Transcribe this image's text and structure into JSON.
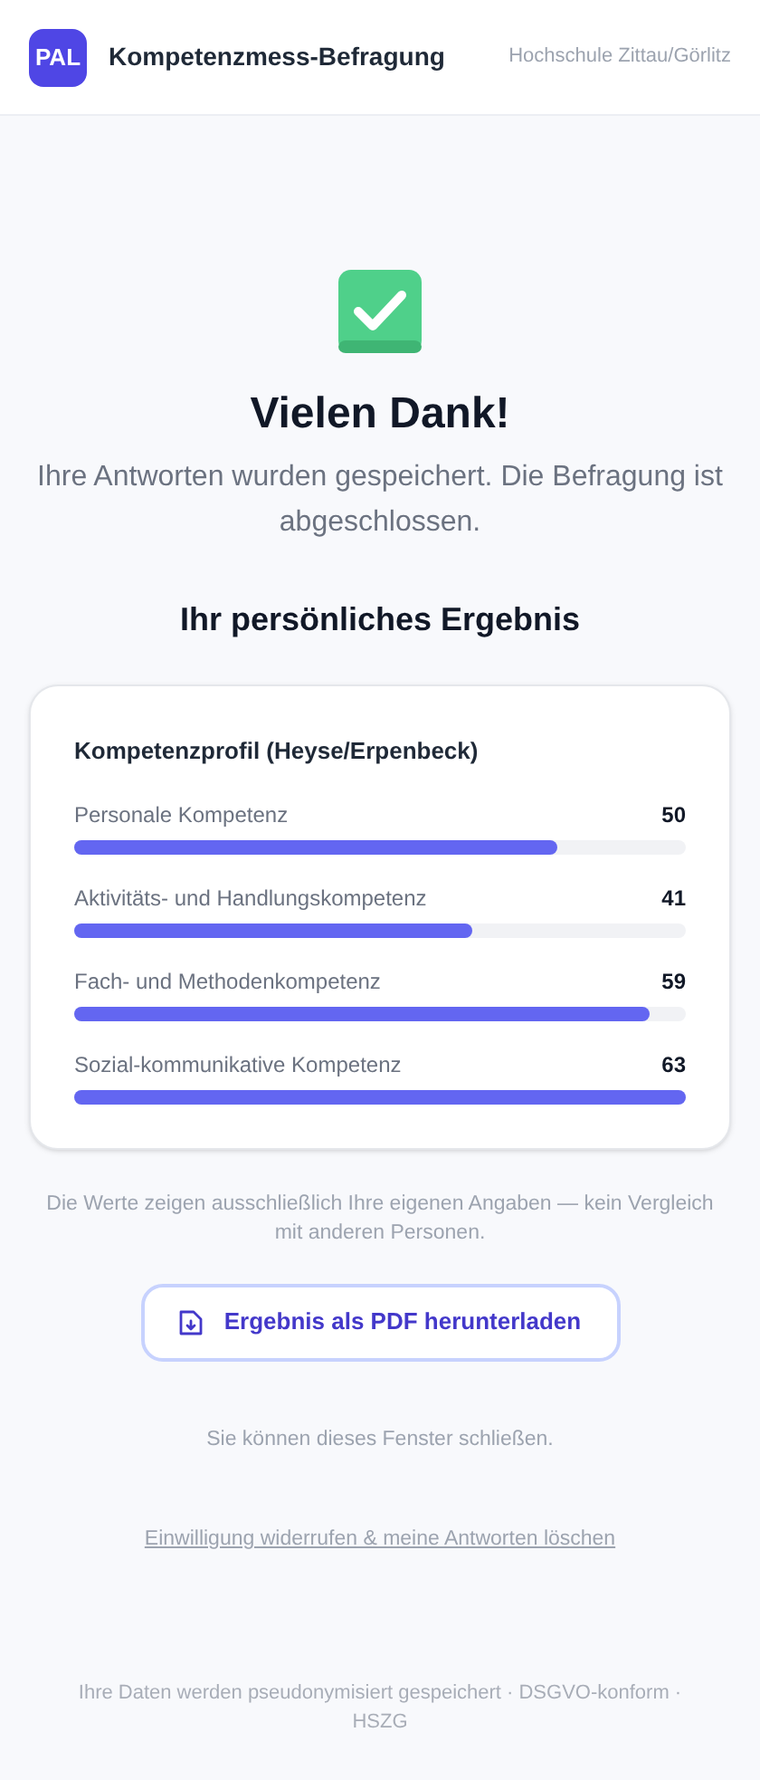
{
  "header": {
    "logo": "PAL",
    "title": "Kompetenzmess-Befragung",
    "institution": "Hochschule Zittau/Görlitz"
  },
  "confirmation": {
    "title": "Vielen Dank!",
    "message": "Ihre Antworten wurden gespeichert. Die Befragung ist abgeschlossen."
  },
  "result": {
    "heading": "Ihr persönliches Ergebnis",
    "card_title": "Kompetenzprofil (Heyse/Erpenbeck)",
    "scores": [
      {
        "label": "Personale Kompetenz",
        "value": "50",
        "level": 0.79
      },
      {
        "label": "Aktivitäts- und Handlungskompetenz",
        "value": "41",
        "level": 0.65
      },
      {
        "label": "Fach- und Methodenkompetenz",
        "value": "59",
        "level": 0.94
      },
      {
        "label": "Sozial-kommunikative Kompetenz",
        "value": "63",
        "level": 1.0
      }
    ]
  },
  "note": "Die Werte zeigen ausschließlich Ihre eigenen Angaben — kein Vergleich mit anderen Personen.",
  "download_button": "Ergebnis als PDF herunterladen",
  "close_hint": "Sie können dieses Fenster schließen.",
  "withdraw_link": "Einwilligung widerrufen & meine Antworten löschen",
  "footer": "Ihre Daten werden pseudonymisiert gespeichert · DSGVO-konform · HSZG"
}
